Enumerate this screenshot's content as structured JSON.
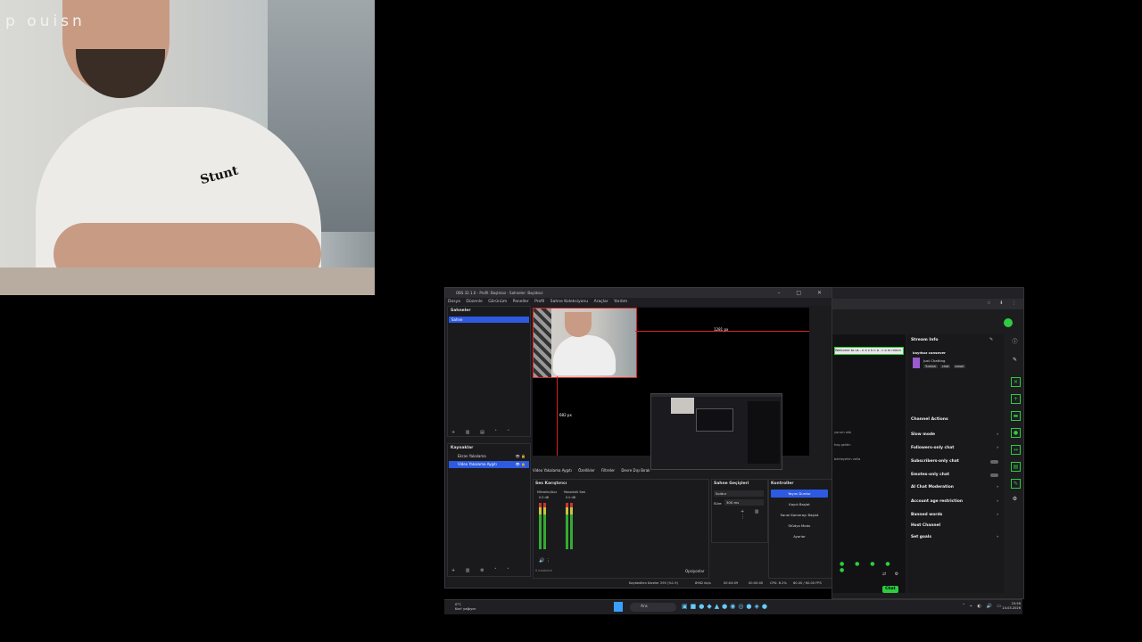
{
  "webcam": {
    "overlay_text": "p ouisn",
    "shirt_logo": "Stunt"
  },
  "obs": {
    "title": "OBS 32.1.0 - Profil: Başlıksız - Sahneler: Başlıksız",
    "window_controls": [
      "–",
      "□",
      "✕"
    ],
    "menu": [
      "Dosya",
      "Düzenle",
      "Görünüm",
      "Paneller",
      "Profil",
      "Sahne Koleksiyonu",
      "Araçlar",
      "Yardım"
    ],
    "scenes": {
      "title": "Sahneler",
      "items": [
        "Sahne"
      ]
    },
    "sources": {
      "title": "Kaynaklar",
      "items": [
        "Ekran Yakalama",
        "Video Yakalama Aygıtı"
      ]
    },
    "preview": {
      "width_label": "1281 px",
      "height_label": "682 px"
    },
    "context_bar": {
      "source": "Video Yakalama Aygıtı",
      "properties": "Özellikler",
      "filters": "Filtreler",
      "deactivate": "Devre Dışı Bırak"
    },
    "mixer": {
      "title": "Ses Karıştırıcı",
      "channels": [
        {
          "name": "Mikrofon/Aux",
          "level": "0.0 dB"
        },
        {
          "name": "Masaüstü Sesi",
          "level": "0.0 dB"
        }
      ],
      "footer": "0 kaldırıldı"
    },
    "transitions": {
      "title": "Sahne Geçişleri",
      "type": "Soldur",
      "duration_label": "Süre",
      "duration": "300 ms"
    },
    "controls": {
      "title": "Kontroller",
      "buttons": [
        "Yayını Durdur",
        "Kaydı Başlat",
        "Sanal Kamerayı Başlat",
        "Stüdyo Modu",
        "Ayarlar"
      ]
    },
    "options_label": "Opsiyonlar",
    "status": {
      "dropped": "Kaybedilen Kareler 295 (%1.9)",
      "bitrate": "8962 kb/s",
      "stream_time": "00:04:09",
      "rec_time": "00:00:00",
      "cpu": "CPU: 8.2%",
      "fps": "60.00 / 60.00 FPS"
    }
  },
  "browser": {
    "chat_banner": "Welcome to us - n e z h n a . c o m mmm",
    "chat_snippets": [
      "yorum aldı",
      "hoş geldin",
      "bekleyelim vella"
    ],
    "stream_info": {
      "title": "Stream Info",
      "channel": "kayıtsız cansever",
      "category": "Just Chatting",
      "tags": [
        "Turkish",
        "chat",
        "omori"
      ]
    },
    "channel_actions": {
      "title": "Channel Actions",
      "items": [
        "Slow mode",
        "Followers-only chat",
        "Subscribers-only chat",
        "Emotes-only chat",
        "AI Chat Moderation",
        "Account age restriction",
        "Banned words",
        "Host Channel",
        "Set goals"
      ]
    },
    "chat_button": "Chat"
  },
  "taskbar": {
    "weather_temp": "0°C",
    "weather_desc": "Kar! yağıyor",
    "search": "Ara",
    "time": "23:56",
    "date": "24.03.2026"
  },
  "colors": {
    "accent_blue": "#2d5ae0",
    "kick_green": "#2ecc40",
    "guide_red": "#dd2222"
  }
}
